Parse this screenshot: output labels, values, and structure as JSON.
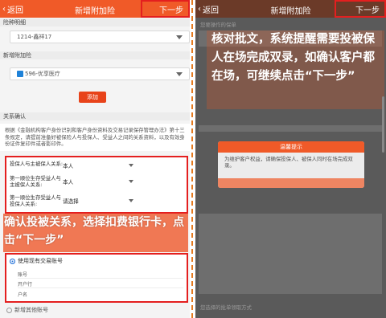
{
  "left": {
    "nav": {
      "back": "返回",
      "title": "新增附加险",
      "next": "下一步"
    },
    "rider_section": "险种明细",
    "rider_select": "1214-鑫祥17",
    "add_rider_section": "新增附加险",
    "add_rider_select": "596-优享医疗",
    "add_button": "添加",
    "relation_section": "关系确认",
    "notice": "根据《金融机构客户身份识别和客户身份资料及交易记录保存管理办法》第十三条规定，请提前准备好被保险人与投保人、受益人之间的关系资料，以及有效身份证件复印件或者影印件。",
    "relations": [
      {
        "label": "投保人与主被保人关系:",
        "value": "本人"
      },
      {
        "label": "第一顺位生存受益人与主被保人关系:",
        "value": "本人"
      },
      {
        "label": "第一顺位生存受益人与投保人关系:",
        "value": "请选择"
      }
    ],
    "annotation": "确认投被关系，选择扣费银行卡，点击“下一步”",
    "account_option": "使用现有交易账号",
    "account_fields": [
      "账号",
      "开户行",
      "户名"
    ],
    "other_account": "新增其他账号"
  },
  "right": {
    "nav": {
      "back": "返回",
      "title": "新增附加险",
      "next": "下一步"
    },
    "annotation": "核对批文，系统提醒需要投被保人在场完成双录，如确认客户都在场，可继续点击“下一步”",
    "dialog_title": "温馨提示",
    "dialog_body": "为维护客户权益，请确保投保人、被保人同时在场完成双录。",
    "section_top": "您要操作的保单",
    "section_bottom": "您选择的批单领取方式"
  },
  "colors": {
    "brand": "#f05a28",
    "highlight_frame": "#e41f1f",
    "divider": "#e67a1e"
  }
}
